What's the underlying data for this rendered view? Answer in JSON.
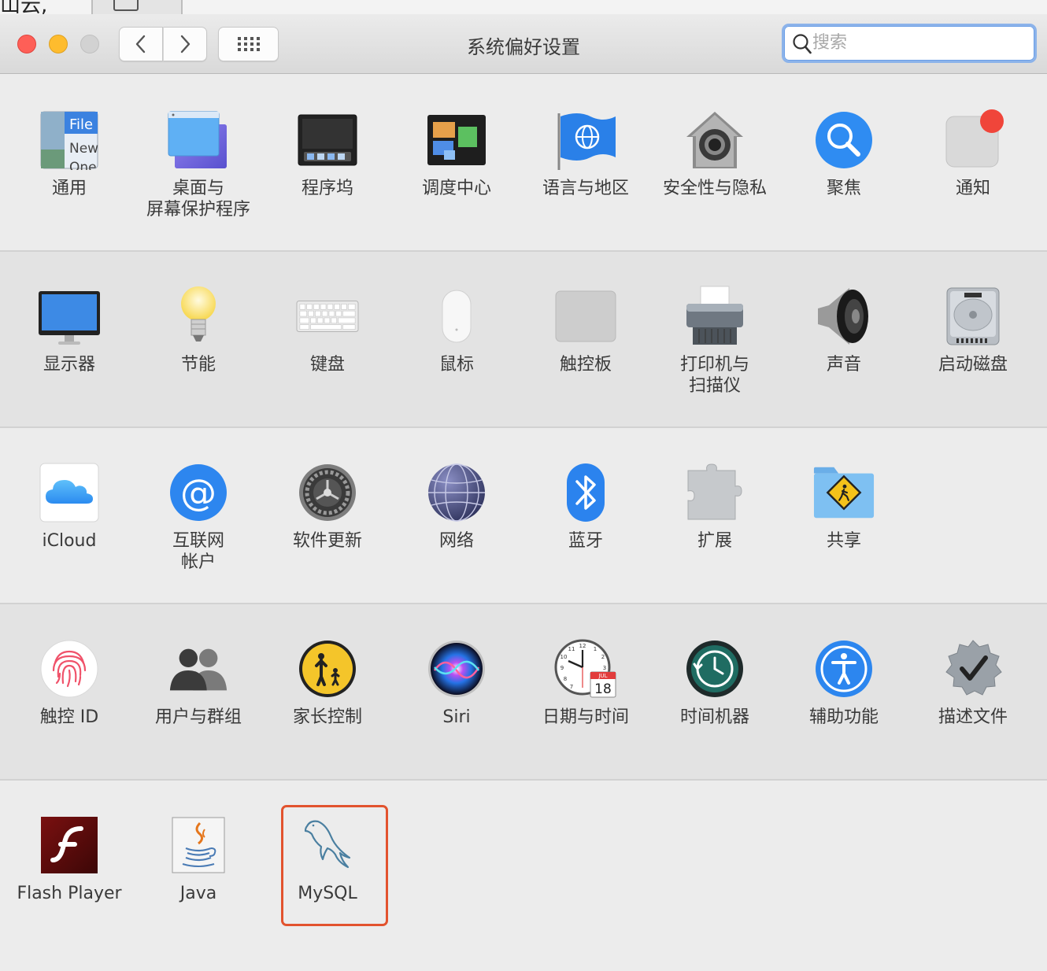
{
  "background": {
    "fragment_text": "山云,"
  },
  "window": {
    "title": "系统偏好设置"
  },
  "search": {
    "placeholder": "搜索",
    "value": ""
  },
  "colors": {
    "close": "#fe5f57",
    "minimize": "#febc2e",
    "zoom": "#d2d2d2",
    "focus_ring": "#8cb3ea",
    "selection_outline": "#e2532e"
  },
  "rows": [
    {
      "items": [
        {
          "label": "通用",
          "icon": "general-icon"
        },
        {
          "label": "桌面与\n屏幕保护程序",
          "icon": "desktop-screensaver-icon"
        },
        {
          "label": "程序坞",
          "icon": "dock-icon"
        },
        {
          "label": "调度中心",
          "icon": "mission-control-icon"
        },
        {
          "label": "语言与地区",
          "icon": "language-region-icon"
        },
        {
          "label": "安全性与隐私",
          "icon": "security-privacy-icon"
        },
        {
          "label": "聚焦",
          "icon": "spotlight-icon"
        },
        {
          "label": "通知",
          "icon": "notifications-icon"
        }
      ]
    },
    {
      "items": [
        {
          "label": "显示器",
          "icon": "displays-icon"
        },
        {
          "label": "节能",
          "icon": "energy-saver-icon"
        },
        {
          "label": "键盘",
          "icon": "keyboard-icon"
        },
        {
          "label": "鼠标",
          "icon": "mouse-icon"
        },
        {
          "label": "触控板",
          "icon": "trackpad-icon"
        },
        {
          "label": "打印机与\n扫描仪",
          "icon": "printers-scanners-icon"
        },
        {
          "label": "声音",
          "icon": "sound-icon"
        },
        {
          "label": "启动磁盘",
          "icon": "startup-disk-icon"
        }
      ]
    },
    {
      "items": [
        {
          "label": "iCloud",
          "icon": "icloud-icon"
        },
        {
          "label": "互联网\n帐户",
          "icon": "internet-accounts-icon"
        },
        {
          "label": "软件更新",
          "icon": "software-update-icon"
        },
        {
          "label": "网络",
          "icon": "network-icon"
        },
        {
          "label": "蓝牙",
          "icon": "bluetooth-icon"
        },
        {
          "label": "扩展",
          "icon": "extensions-icon"
        },
        {
          "label": "共享",
          "icon": "sharing-icon"
        }
      ]
    },
    {
      "items": [
        {
          "label": "触控 ID",
          "icon": "touch-id-icon"
        },
        {
          "label": "用户与群组",
          "icon": "users-groups-icon"
        },
        {
          "label": "家长控制",
          "icon": "parental-controls-icon"
        },
        {
          "label": "Siri",
          "icon": "siri-icon"
        },
        {
          "label": "日期与时间",
          "icon": "date-time-icon"
        },
        {
          "label": "时间机器",
          "icon": "time-machine-icon"
        },
        {
          "label": "辅助功能",
          "icon": "accessibility-icon"
        },
        {
          "label": "描述文件",
          "icon": "profiles-icon"
        }
      ]
    },
    {
      "items": [
        {
          "label": "Flash Player",
          "icon": "flash-player-icon"
        },
        {
          "label": "Java",
          "icon": "java-icon"
        },
        {
          "label": "MySQL",
          "icon": "mysql-icon"
        }
      ]
    }
  ],
  "date_icon": {
    "month": "JUL",
    "day": "18"
  },
  "general_icon": {
    "line1": "File",
    "line2": "New",
    "line3": "One"
  }
}
